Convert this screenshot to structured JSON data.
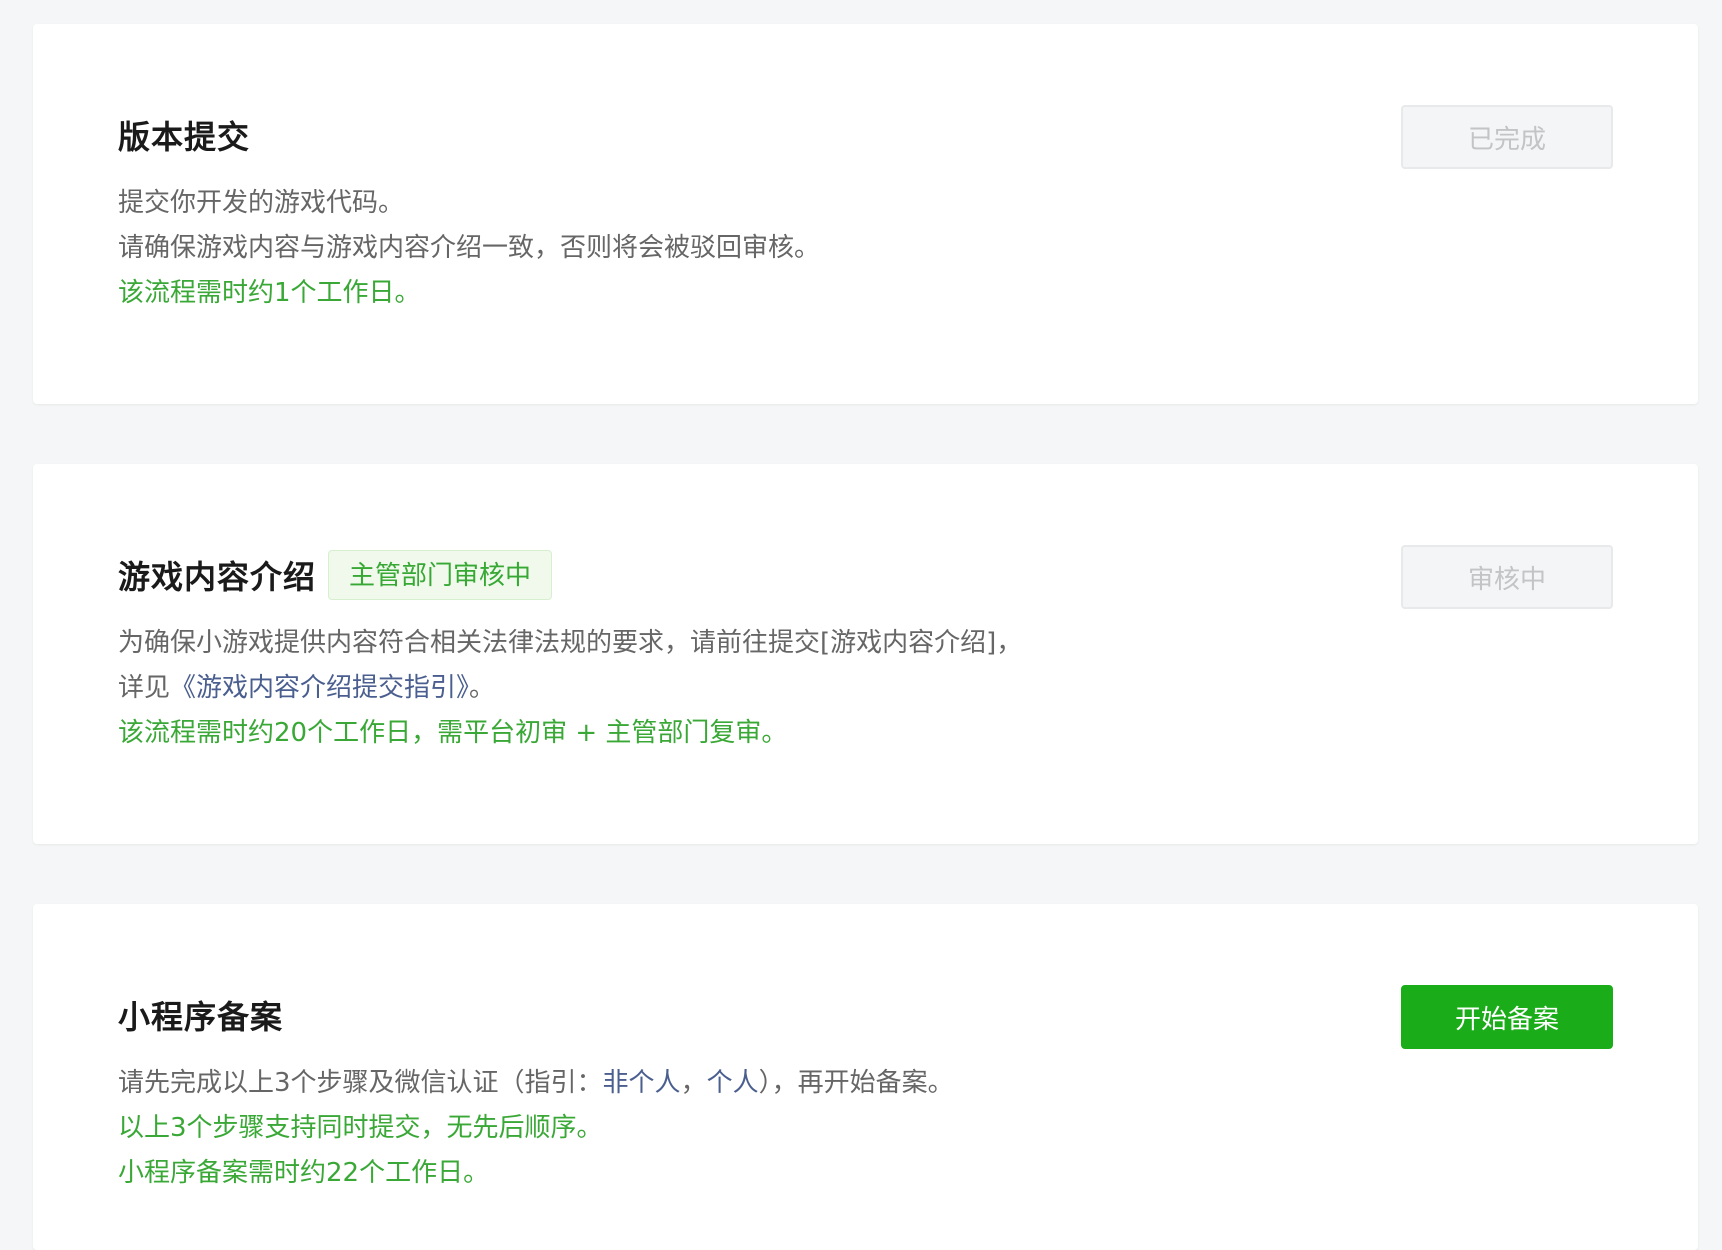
{
  "cards": [
    {
      "title": "版本提交",
      "button": "已完成",
      "lines": [
        "提交你开发的游戏代码。",
        "请确保游戏内容与游戏内容介绍一致，否则将会被驳回审核。",
        "该流程需时约1个工作日。"
      ]
    },
    {
      "title": "游戏内容介绍",
      "tag": "主管部门审核中",
      "button": "审核中",
      "lines": [
        "为确保小游戏提供内容符合相关法律法规的要求，请前往提交[游戏内容介绍]，"
      ],
      "line2_prefix": "详见",
      "line2_link": "《游戏内容介绍提交指引》",
      "line2_suffix": "。",
      "line3": "该流程需时约20个工作日，需平台初审 + 主管部门复审。"
    },
    {
      "title": "小程序备案",
      "button": "开始备案",
      "line1_prefix": "请先完成以上3个步骤及微信认证（指引：",
      "line1_link1": "非个人",
      "line1_sep": "，",
      "line1_link2": "个人",
      "line1_suffix": "），再开始备案。",
      "line2": "以上3个步骤支持同时提交，无先后顺序。",
      "line3": "小程序备案需时约22个工作日。"
    }
  ],
  "colors": {
    "accent_green": "#1aad19",
    "tip_green": "#3aa836",
    "link_blue": "#4a5f8f",
    "background": "#f5f6f7"
  }
}
